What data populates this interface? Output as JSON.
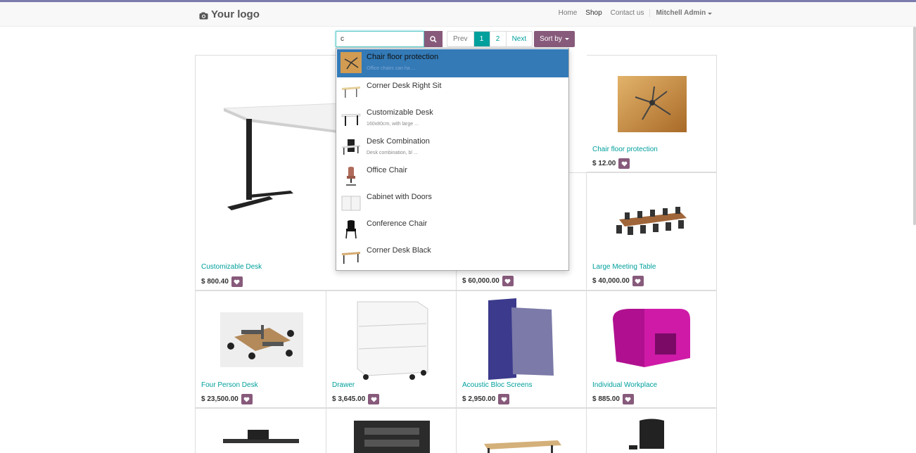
{
  "header": {
    "logo_text": "Your logo",
    "nav": [
      "Home",
      "Shop",
      "Contact us"
    ],
    "user": "Mitchell Admin"
  },
  "search": {
    "value": "c"
  },
  "pager": {
    "prev": "Prev",
    "pages": [
      "1",
      "2"
    ],
    "next": "Next",
    "current": "1"
  },
  "sort_label": "Sort by",
  "autocomplete": [
    {
      "title": "Chair floor protection",
      "desc": "Office chairs can ha ..."
    },
    {
      "title": "Corner Desk Right Sit",
      "desc": ""
    },
    {
      "title": "Customizable Desk",
      "desc": "160x80cm, with large ..."
    },
    {
      "title": "Desk Combination",
      "desc": "Desk combination, bl ..."
    },
    {
      "title": "Office Chair",
      "desc": ""
    },
    {
      "title": "Cabinet with Doors",
      "desc": ""
    },
    {
      "title": "Conference Chair",
      "desc": ""
    },
    {
      "title": "Corner Desk Black",
      "desc": ""
    }
  ],
  "products": {
    "big": {
      "name": "Customizable Desk",
      "price": "$ 800.40"
    },
    "hidden_row1": {
      "price": "$ 60,000.00"
    },
    "chair_floor": {
      "name": "Chair floor protection",
      "price": "$ 12.00"
    },
    "meeting_table": {
      "name": "Large Meeting Table",
      "price": "$ 40,000.00"
    },
    "four_person": {
      "name": "Four Person Desk",
      "price": "$ 23,500.00"
    },
    "drawer": {
      "name": "Drawer",
      "price": "$ 3,645.00"
    },
    "acoustic": {
      "name": "Acoustic Bloc Screens",
      "price": "$ 2,950.00"
    },
    "workplace": {
      "name": "Individual Workplace",
      "price": "$ 885.00"
    }
  },
  "colors": {
    "accent": "#00a09d",
    "brand": "#875a7b",
    "selection": "#337ab7"
  }
}
